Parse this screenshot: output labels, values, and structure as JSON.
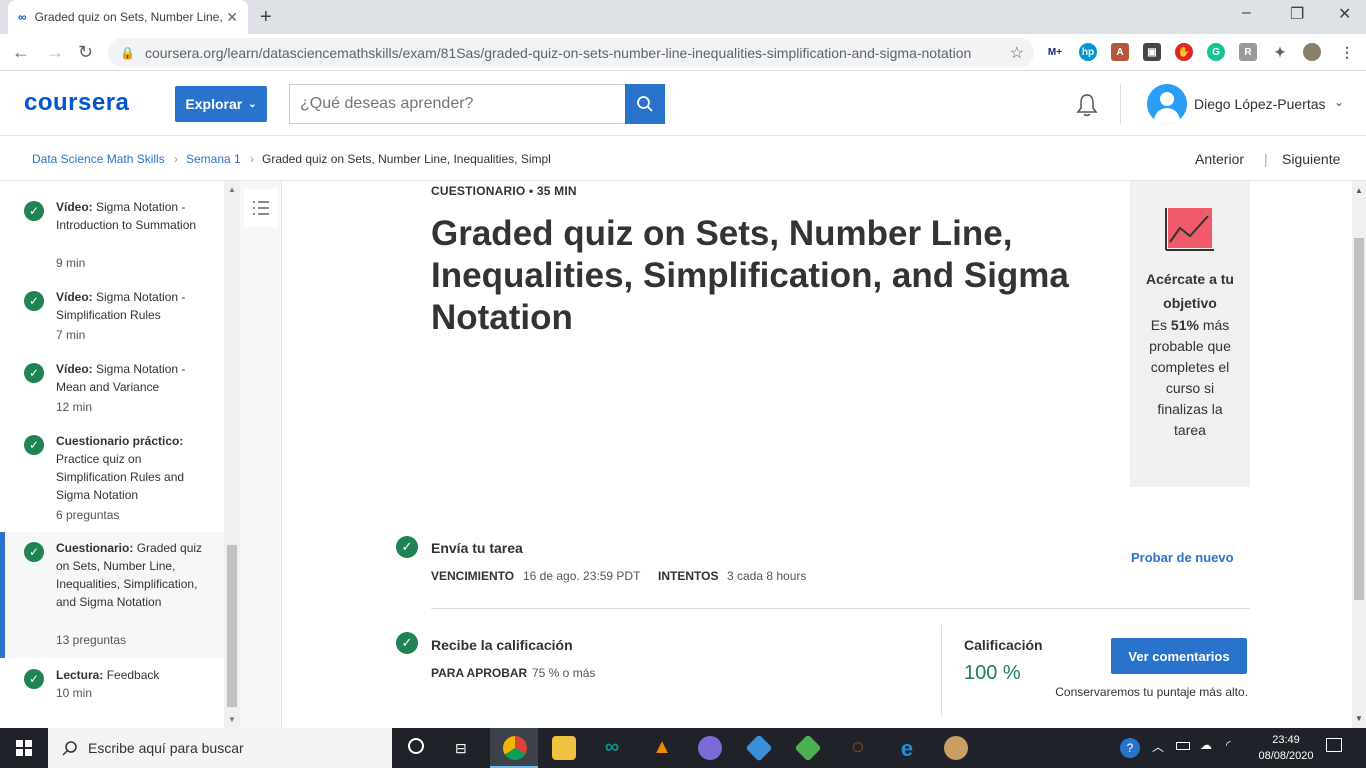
{
  "browser": {
    "tab_title": "Graded quiz on Sets, Number Line, Inequalities...",
    "url": "coursera.org/learn/datasciencemathskills/exam/81Sas/graded-quiz-on-sets-number-line-inequalities-simplification-and-sigma-notation"
  },
  "header": {
    "logo": "coursera",
    "explore_label": "Explorar",
    "search_placeholder": "¿Qué deseas aprender?",
    "username": "Diego López-Puertas"
  },
  "breadcrumb": {
    "course": "Data Science Math Skills",
    "week": "Semana 1",
    "current": "Graded quiz on Sets, Number Line, Inequalities, Simpl",
    "prev": "Anterior",
    "next": "Siguiente"
  },
  "sidebar": {
    "items": [
      {
        "kind": "Vídeo:",
        "title": "Sigma Notation - Introduction to Summation",
        "meta": "9 min"
      },
      {
        "kind": "Vídeo:",
        "title": "Sigma Notation - Simplification Rules",
        "meta": "7 min"
      },
      {
        "kind": "Vídeo:",
        "title": "Sigma Notation - Mean and Variance",
        "meta": "12 min"
      },
      {
        "kind": "Cuestionario práctico:",
        "title": "Practice quiz on Simplification Rules and Sigma Notation",
        "meta": "6 preguntas"
      },
      {
        "kind": "Cuestionario:",
        "title": "Graded quiz on Sets, Number Line, Inequalities, Simplification, and Sigma Notation",
        "meta": "13 preguntas"
      },
      {
        "kind": "Lectura:",
        "title": "Feedback",
        "meta": "10 min"
      }
    ]
  },
  "main": {
    "kicker": "CUESTIONARIO • 35 MIN",
    "title": "Graded quiz on Sets, Number Line, Inequalities, Simplification, and Sigma Notation",
    "goal_card": {
      "title": "Acércate a tu objetivo",
      "body_pre": "Es ",
      "body_bold": "51%",
      "body_post": " más probable que completes el curso si finalizas la tarea"
    },
    "step1": {
      "title": "Envía tu tarea",
      "due_label": "VENCIMIENTO",
      "due_value": "16 de ago. 23:59 PDT",
      "attempts_label": "INTENTOS",
      "attempts_value": "3 cada 8 hours",
      "retry": "Probar de nuevo"
    },
    "step2": {
      "title": "Recibe la calificación",
      "pass_label": "PARA APROBAR",
      "pass_value": "75 % o más",
      "grade_label": "Calificación",
      "grade_value": "100 %",
      "feedback_button": "Ver comentarios",
      "keep_note": "Conservaremos tu puntaje más alto."
    }
  },
  "taskbar": {
    "search_placeholder": "Escribe aquí para buscar",
    "time": "23:49",
    "date": "08/08/2020"
  },
  "colors": {
    "brand": "#0056d2",
    "accent": "#2a73cc",
    "success": "#1f8354"
  }
}
